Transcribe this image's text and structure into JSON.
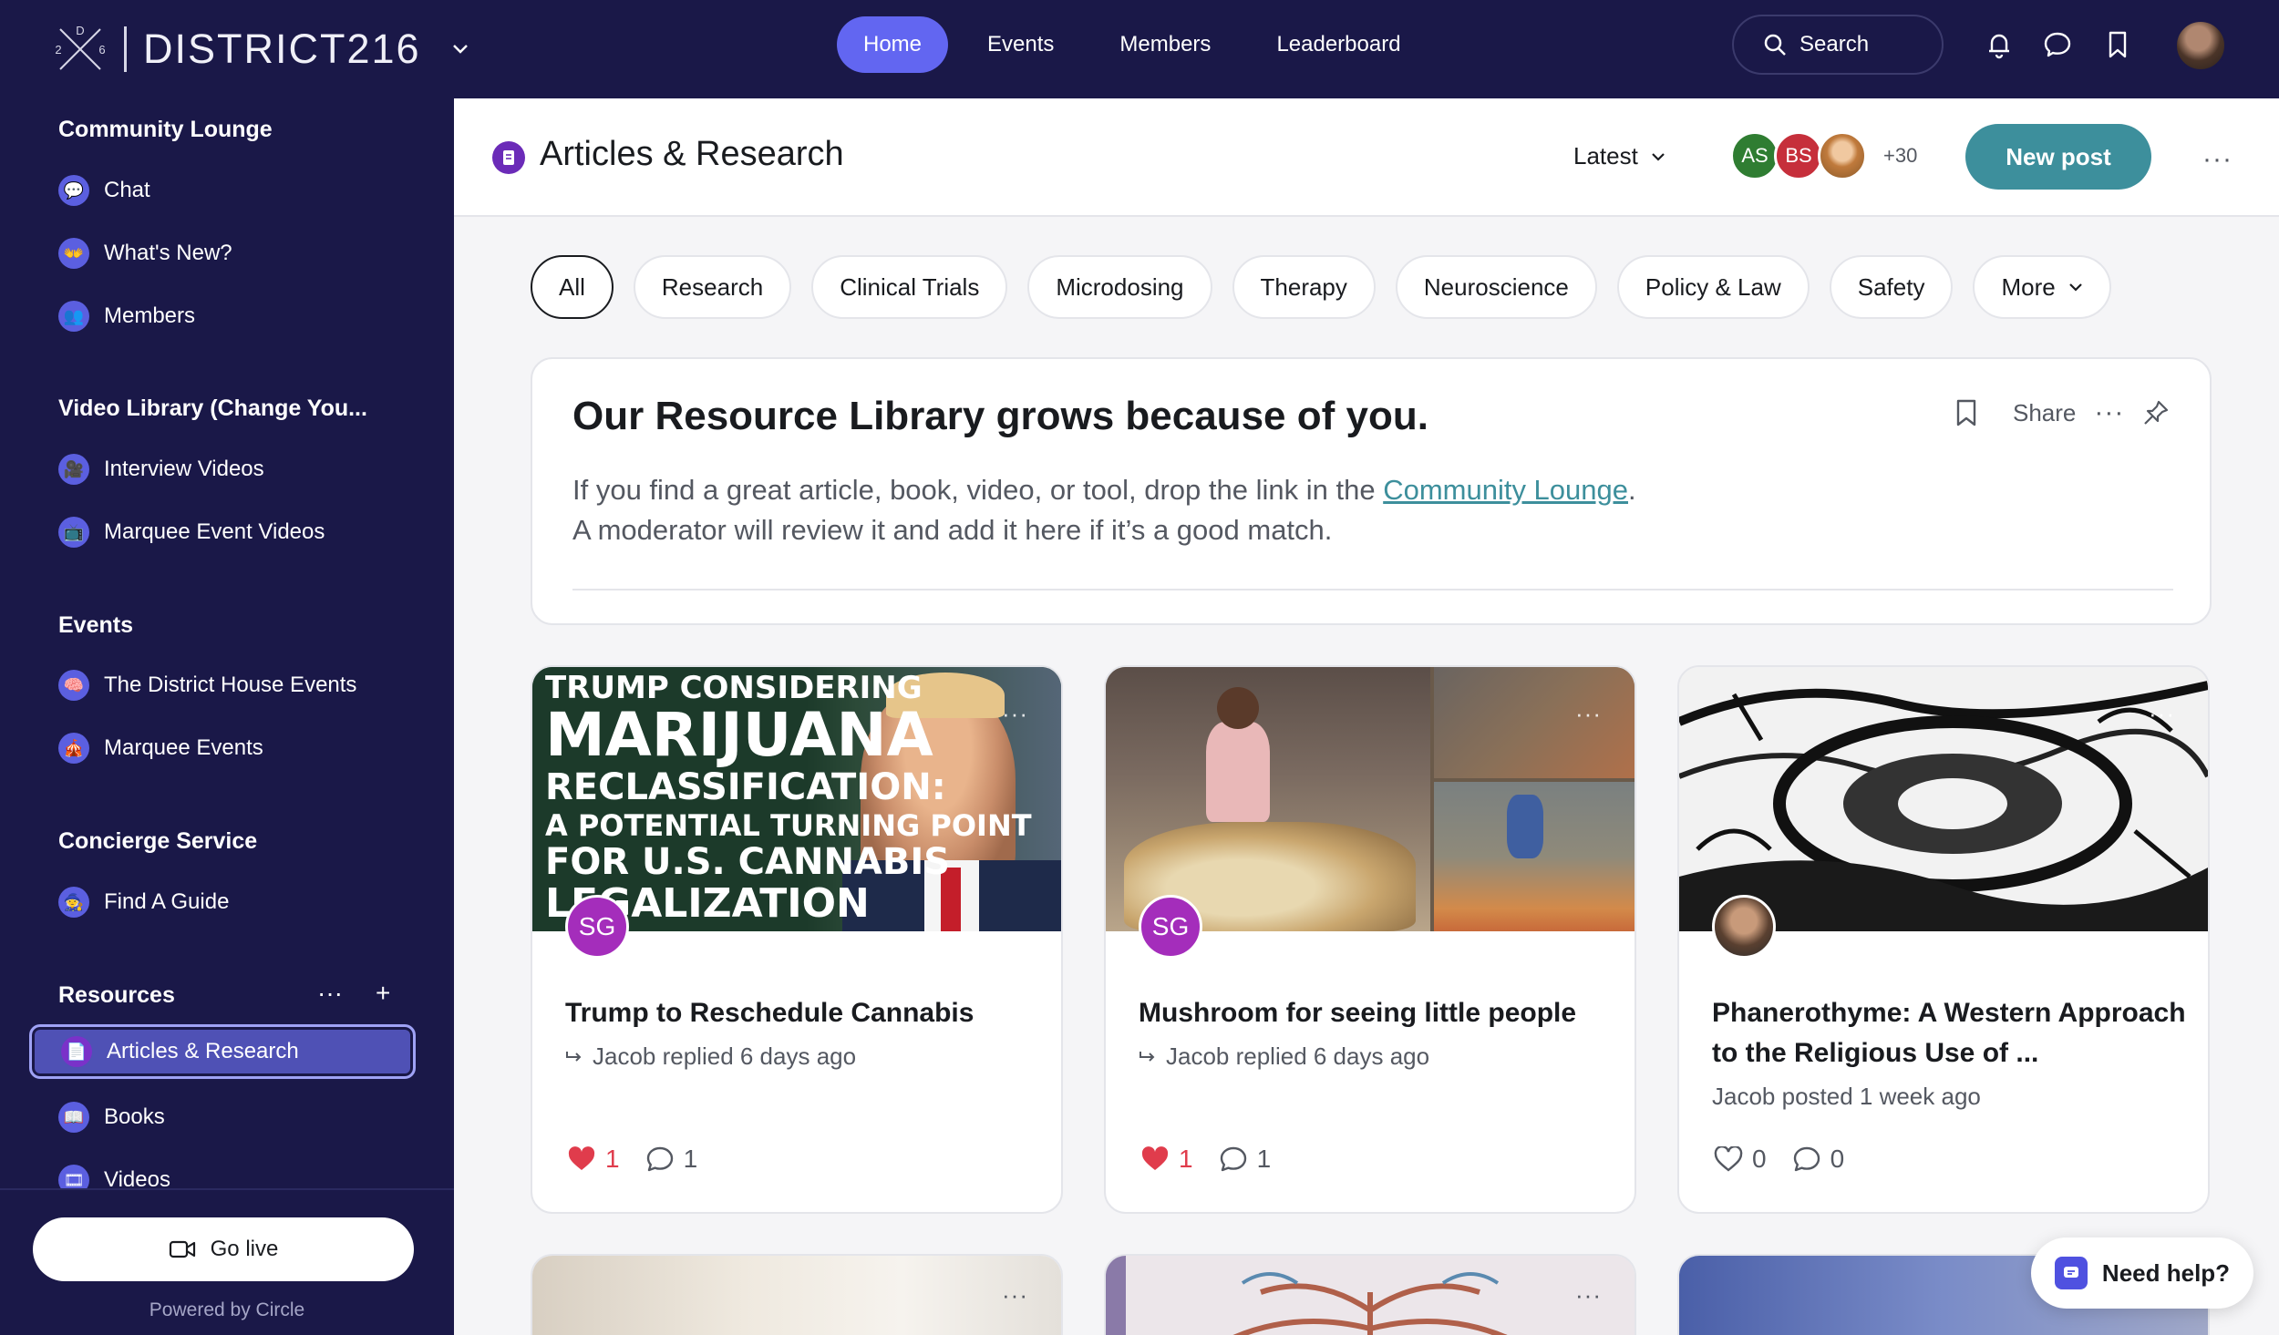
{
  "brand": {
    "name": "DISTRICT216",
    "mark_letters": "2 D 6"
  },
  "nav": {
    "links": [
      {
        "label": "Home",
        "active": true
      },
      {
        "label": "Events",
        "active": false
      },
      {
        "label": "Members",
        "active": false
      },
      {
        "label": "Leaderboard",
        "active": false
      }
    ],
    "search_label": "Search"
  },
  "sidebar": {
    "sections": [
      {
        "heading": "Community Lounge",
        "items": [
          "Chat",
          "What's New?",
          "Members"
        ]
      },
      {
        "heading": "Video Library (Change You...",
        "items": [
          "Interview Videos",
          "Marquee Event Videos"
        ]
      },
      {
        "heading": "Events",
        "items": [
          "The District House Events",
          "Marquee Events"
        ]
      },
      {
        "heading": "Concierge Service",
        "items": [
          "Find A Guide"
        ]
      },
      {
        "heading": "Resources",
        "items": [
          "Articles & Research",
          "Books",
          "Videos"
        ]
      }
    ],
    "active_item": "Articles & Research",
    "go_live": "Go live",
    "powered_by": "Powered by Circle"
  },
  "header": {
    "title": "Articles & Research",
    "sort": "Latest",
    "avatars": [
      {
        "initials": "AS",
        "color": "#2f7d32"
      },
      {
        "initials": "BS",
        "color": "#c62f3b"
      },
      {
        "initials": "",
        "color": "#d39b3d"
      }
    ],
    "avatars_more": "+30",
    "new_post": "New post"
  },
  "filters": [
    "All",
    "Research",
    "Clinical Trials",
    "Microdosing",
    "Therapy",
    "Neuroscience",
    "Policy & Law",
    "Safety",
    "More"
  ],
  "active_filter": "All",
  "pinned": {
    "title": "Our Resource Library grows because of you.",
    "share": "Share",
    "line1_before": "If you find a great article, book, video, or tool, drop the link in the ",
    "line1_link": "Community Lounge",
    "line1_after": ".",
    "line2": "A moderator will review it and add it here if it’s a good match."
  },
  "posts": [
    {
      "image_text": [
        "TRUMP CONSIDERING",
        "MARIJUANA",
        "RECLASSIFICATION:",
        "A POTENTIAL TURNING POINT",
        "FOR U.S. CANNABIS",
        "LEGALIZATION"
      ],
      "author_initials": "SG",
      "title": "Trump to Reschedule Cannabis",
      "meta": "Jacob replied 6 days ago",
      "likes": "1",
      "comments": "1",
      "liked": true
    },
    {
      "author_initials": "SG",
      "title": "Mushroom for seeing little people",
      "meta": "Jacob replied 6 days ago",
      "likes": "1",
      "comments": "1",
      "liked": true
    },
    {
      "author_initials": "",
      "title": "Phanerothyme: A Western Approach to the Religious Use of ...",
      "meta": "Jacob posted 1 week ago",
      "likes": "0",
      "comments": "0",
      "liked": false
    }
  ],
  "help_label": "Need help?"
}
